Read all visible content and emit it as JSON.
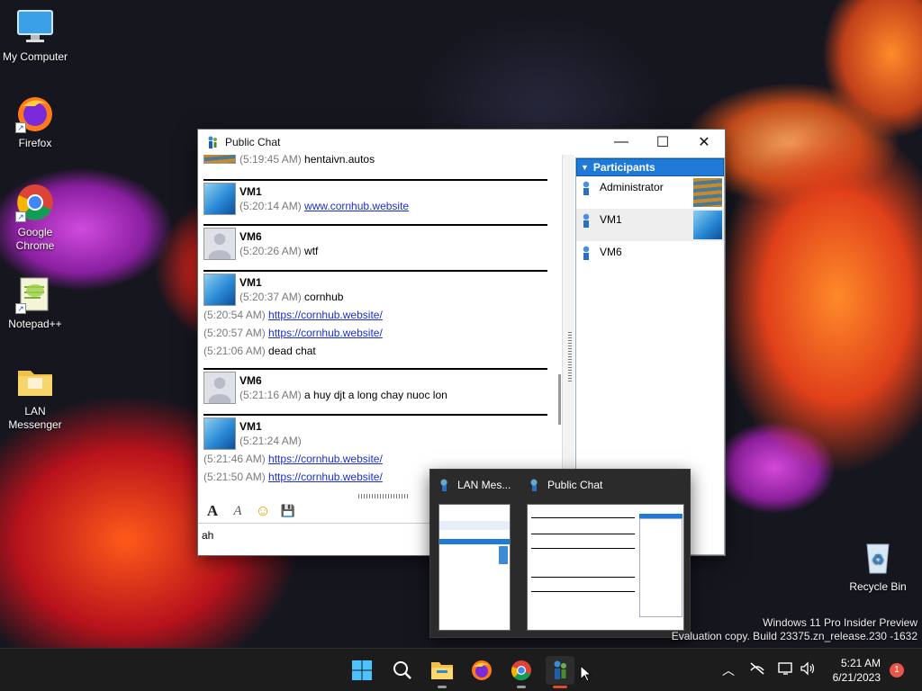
{
  "desktop": {
    "icons": [
      {
        "label": "My Computer",
        "icon": "monitor-icon"
      },
      {
        "label": "Firefox",
        "icon": "firefox-icon"
      },
      {
        "label": "Google Chrome",
        "icon": "chrome-icon"
      },
      {
        "label": "Notepad++",
        "icon": "notepadpp-icon"
      },
      {
        "label": "LAN Messenger",
        "icon": "folder-icon"
      },
      {
        "label": "Recycle Bin",
        "icon": "recycle-bin-icon"
      }
    ],
    "watermark": {
      "line1": "Windows 11 Pro Insider Preview",
      "line2": "Evaluation copy. Build 23375.zn_release.230 -1632"
    }
  },
  "window": {
    "title": "Public Chat",
    "controls": {
      "minimize": "—",
      "maximize": "☐",
      "close": "✕"
    },
    "chat": {
      "messages": [
        {
          "sender": "",
          "lines": [
            {
              "ts": "(5:19:45 AM)",
              "text": "hentaivn.autos"
            }
          ]
        },
        {
          "sender": "VM1",
          "lines": [
            {
              "ts": "(5:20:14 AM)",
              "link": "www.cornhub.website"
            }
          ]
        },
        {
          "sender": "VM6",
          "lines": [
            {
              "ts": "(5:20:26 AM)",
              "text": "wtf"
            }
          ]
        },
        {
          "sender": "VM1",
          "lines": [
            {
              "ts": "(5:20:37 AM)",
              "text": "cornhub"
            },
            {
              "ts": "(5:20:54 AM)",
              "link": "https://cornhub.website/"
            },
            {
              "ts": "(5:20:57 AM)",
              "link": "https://cornhub.website/"
            },
            {
              "ts": "(5:21:06 AM)",
              "text": "dead chat"
            }
          ]
        },
        {
          "sender": "VM6",
          "lines": [
            {
              "ts": "(5:21:16 AM)",
              "text": "a huy djt a long chay nuoc lon"
            }
          ]
        },
        {
          "sender": "VM1",
          "lines": [
            {
              "ts": "(5:21:24 AM)",
              "text": ""
            },
            {
              "ts": "(5:21:46 AM)",
              "link": "https://cornhub.website/"
            },
            {
              "ts": "(5:21:50 AM)",
              "link": "https://cornhub.website/"
            }
          ]
        }
      ]
    },
    "toolbar": {
      "font": "A",
      "font_style": "A",
      "emoji": "☺",
      "save": "💾"
    },
    "input": {
      "value": "ah"
    },
    "participants": {
      "header": "Participants",
      "items": [
        {
          "name": "Administrator"
        },
        {
          "name": "VM1"
        },
        {
          "name": "VM6"
        }
      ]
    }
  },
  "taskbar_preview": {
    "items": [
      {
        "title": "LAN Mes..."
      },
      {
        "title": "Public Chat"
      }
    ]
  },
  "taskbar": {
    "clock_time": "5:21 AM",
    "clock_date": "6/21/2023",
    "notification_count": "1"
  },
  "colors": {
    "participants_header": "#1e7ad6",
    "link": "#1a2fd0",
    "taskbar": "#1c1c1c"
  }
}
